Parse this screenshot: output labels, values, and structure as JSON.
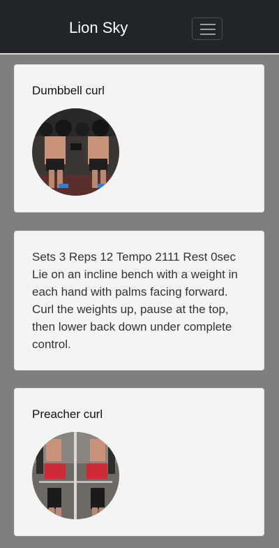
{
  "navbar": {
    "brand": "Lion Sky",
    "menu_icon": "hamburger-menu-icon"
  },
  "cards": [
    {
      "title": "Dumbbell curl",
      "image_icon": "dumbbell-curl-photo"
    },
    {
      "description": "Sets 3 Reps 12 Tempo 2111 Rest 0sec Lie on an incline bench with a weight in each hand with palms facing forward. Curl the weights up, pause at the top, then lower back down under complete control."
    },
    {
      "title": "Preacher curl",
      "image_icon": "preacher-curl-photo"
    }
  ],
  "colors": {
    "navbar_bg": "#212428",
    "page_bg": "#808080",
    "card_bg": "#f4f4f4"
  }
}
